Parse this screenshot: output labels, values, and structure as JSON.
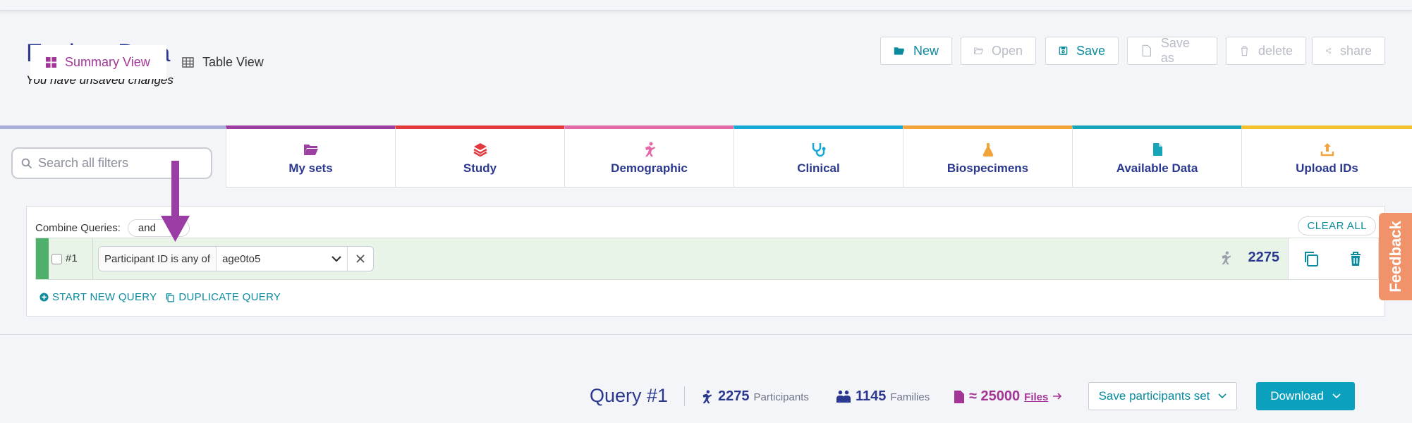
{
  "header": {
    "title": "Explore Data",
    "subtitle": "You have unsaved changes",
    "buttons": {
      "new": "New",
      "open": "Open",
      "save": "Save",
      "save_as": "Save as",
      "delete": "delete",
      "share": "share"
    }
  },
  "filters": {
    "search_placeholder": "Search all filters",
    "categories": {
      "my_sets": "My sets",
      "study": "Study",
      "demographic": "Demographic",
      "clinical": "Clinical",
      "biospecimens": "Biospecimens",
      "available_data": "Available Data",
      "upload_ids": "Upload IDs"
    },
    "category_colors": {
      "search": "#a9aed8",
      "my_sets": "#9b3fa0",
      "study": "#e03a3e",
      "demographic": "#e368a8",
      "clinical": "#17a9d6",
      "biospecimens": "#f2a43a",
      "available_data": "#17a3b8",
      "upload_ids": "#f2c12e"
    }
  },
  "query_builder": {
    "combine_label": "Combine Queries:",
    "combine_value": "and",
    "clear_all": "CLEAR ALL",
    "query": {
      "number": "#1",
      "field": "Participant ID is any of",
      "value": "age0to5",
      "count": "2275"
    },
    "start_new": "START NEW QUERY",
    "duplicate": "DUPLICATE QUERY"
  },
  "feedback": "Feedback",
  "results": {
    "tabs": {
      "summary": "Summary View",
      "table": "Table View"
    },
    "query_title": "Query #1",
    "participants_count": "2275",
    "participants_label": "Participants",
    "families_count": "1145",
    "families_label": "Families",
    "files_count": "≈ 25000",
    "files_label": "Files",
    "save_participants": "Save participants set",
    "download": "Download"
  },
  "colors": {
    "primary": "#2b388f",
    "accent": "#0b8a9e",
    "query_bar": "#4fb06b",
    "arrow": "#9a3ea6",
    "feedback": "#f0936a",
    "download": "#0ba0bd"
  }
}
